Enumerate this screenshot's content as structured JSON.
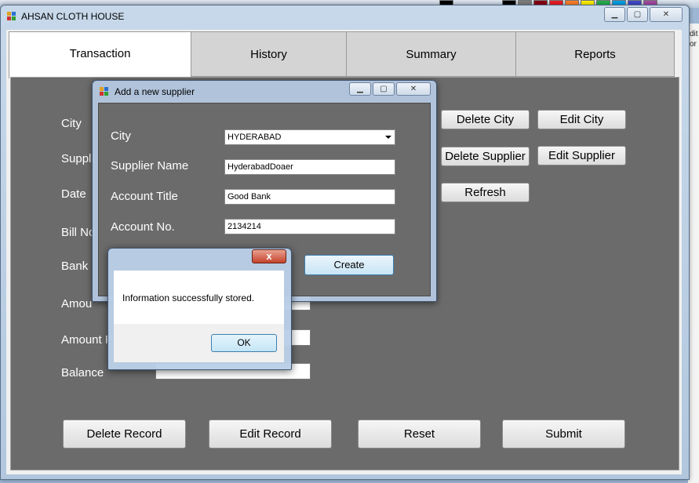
{
  "window": {
    "title": "AHSAN CLOTH HOUSE",
    "caption": {
      "minimize": "▁",
      "maximize": "▢",
      "close": "✕"
    }
  },
  "tabs": [
    {
      "label": "Transaction",
      "active": true
    },
    {
      "label": "History"
    },
    {
      "label": "Summary"
    },
    {
      "label": "Reports"
    }
  ],
  "form": {
    "labels": {
      "city": "City",
      "supplier": "Suppli",
      "date": "Date",
      "bill_no": "Bill No",
      "bank": "Bank",
      "amount": "Amou",
      "amount_paid": "Amount P",
      "balance": "Balance"
    }
  },
  "side_buttons": {
    "delete_city": "Delete City",
    "edit_city": "Edit City",
    "delete_supplier": "Delete Supplier",
    "edit_supplier": "Edit Supplier",
    "refresh": "Refresh"
  },
  "bottom_buttons": {
    "delete_record": "Delete Record",
    "edit_record": "Edit Record",
    "reset": "Reset",
    "submit": "Submit"
  },
  "supplier_dialog": {
    "title": "Add a new supplier",
    "labels": {
      "city": "City",
      "supplier_name": "Supplier Name",
      "account_title": "Account Title",
      "account_no": "Account No."
    },
    "values": {
      "city": "HYDERABAD",
      "supplier_name": "HyderabadDoaer",
      "account_title": "Good Bank",
      "account_no": "2134214"
    },
    "create_label": "Create"
  },
  "message_box": {
    "text": "Information successfully stored.",
    "ok_label": "OK",
    "close_glyph": "x"
  },
  "background_app": {
    "side_text_1": "dit",
    "side_text_2": "or"
  },
  "colors": {
    "panel": "#6b6b6b",
    "title_bar": "#c7d8ea",
    "ok_focus": "#3c7fb1"
  }
}
